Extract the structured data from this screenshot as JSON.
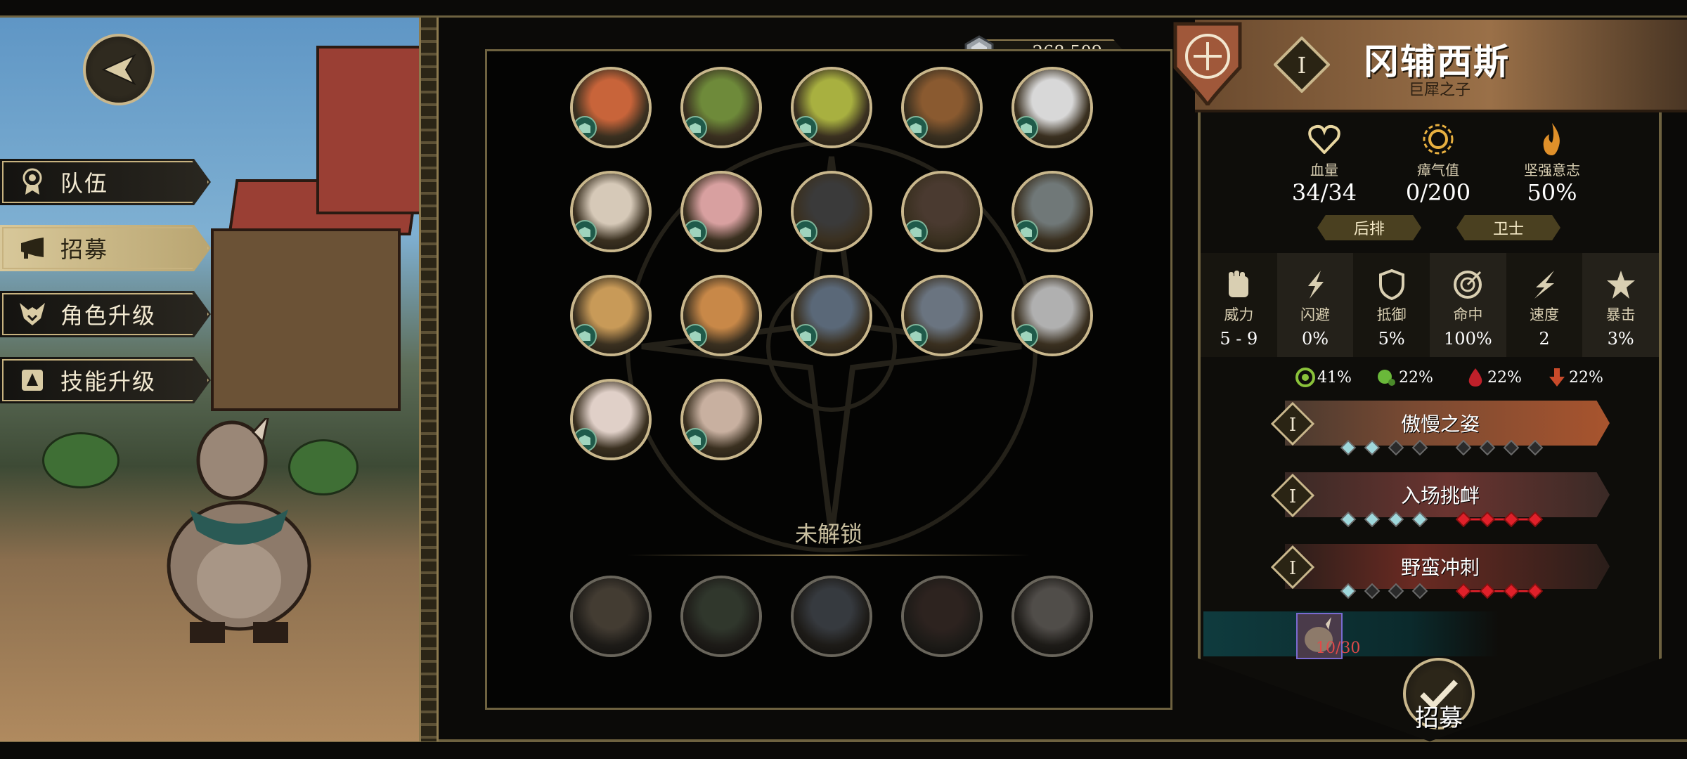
{
  "currency": {
    "value": "268,509",
    "icon": "gem-icon"
  },
  "menu": [
    {
      "label": "队伍",
      "icon": "rosette-icon",
      "active": false
    },
    {
      "label": "招募",
      "icon": "horn-icon",
      "active": true
    },
    {
      "label": "角色升级",
      "icon": "fox-emblem-icon",
      "active": false
    },
    {
      "label": "技能升级",
      "icon": "skill-book-icon",
      "active": false
    }
  ],
  "roster": {
    "unlocked": [
      {
        "name": "fox",
        "color": "#c8643a"
      },
      {
        "name": "lizard",
        "color": "#6e8a3a"
      },
      {
        "name": "jester-frog",
        "color": "#a8b040"
      },
      {
        "name": "bear-guard",
        "color": "#8a5a30"
      },
      {
        "name": "masked-raccoon",
        "color": "#d8d8d8"
      },
      {
        "name": "knight-duck",
        "color": "#d6c9b8"
      },
      {
        "name": "pig-rogue",
        "color": "#d8a0a0"
      },
      {
        "name": "black-cat",
        "color": "#3a3a3a"
      },
      {
        "name": "dark-wolf",
        "color": "#4a3a30"
      },
      {
        "name": "gray-rat",
        "color": "#707878"
      },
      {
        "name": "goggle-mouse",
        "color": "#c89a58"
      },
      {
        "name": "beret-dog",
        "color": "#c88848"
      },
      {
        "name": "armored-rat",
        "color": "#5a6878"
      },
      {
        "name": "owl",
        "color": "#6a7480"
      },
      {
        "name": "monocle-rat",
        "color": "#b0b0b0"
      },
      {
        "name": "pale-pig",
        "color": "#e0d0c8"
      },
      {
        "name": "captain-mouse",
        "color": "#c8b0a0"
      }
    ],
    "locked_label": "未解锁",
    "locked": [
      {
        "name": "hat-mole",
        "color": "#8a6a40"
      },
      {
        "name": "witch-rat",
        "color": "#4a6a3a"
      },
      {
        "name": "rhino-knight",
        "color": "#5a6a80"
      },
      {
        "name": "crow-warrior",
        "color": "#6a3a2a"
      },
      {
        "name": "rhino",
        "color": "#9a8a7a"
      }
    ]
  },
  "character": {
    "rank": "I",
    "name": "冈辅西斯",
    "title": "巨犀之子",
    "hp_label": "血量",
    "hp_value": "34/34",
    "stress_label": "瘴气值",
    "stress_value": "0/200",
    "resolve_label": "坚强意志",
    "resolve_value": "50%",
    "roles": [
      "后排",
      "卫士"
    ],
    "attributes": [
      {
        "label": "威力",
        "value": "5 - 9",
        "icon": "fist-icon"
      },
      {
        "label": "闪避",
        "value": "0%",
        "icon": "dodge-icon"
      },
      {
        "label": "抵御",
        "value": "5%",
        "icon": "shield-icon"
      },
      {
        "label": "命中",
        "value": "100%",
        "icon": "target-icon"
      },
      {
        "label": "速度",
        "value": "2",
        "icon": "speed-icon"
      },
      {
        "label": "暴击",
        "value": "3%",
        "icon": "crit-star-icon"
      }
    ],
    "resistances": [
      {
        "value": "41%",
        "icon": "stun-resist-icon",
        "color": "#8ac23a"
      },
      {
        "value": "22%",
        "icon": "poison-resist-icon",
        "color": "#6ab83a"
      },
      {
        "value": "22%",
        "icon": "bleed-resist-icon",
        "color": "#c0202a"
      },
      {
        "value": "22%",
        "icon": "debuff-resist-icon",
        "color": "#c84a2a"
      }
    ],
    "skills": [
      {
        "rank": "I",
        "name": "傲慢之姿",
        "band": "#a8542e",
        "left_pips": [
          true,
          true,
          false,
          false
        ],
        "right_pips": [
          "off",
          "off",
          "off",
          "off"
        ]
      },
      {
        "rank": "I",
        "name": "入场挑衅",
        "band": "#6a3430",
        "left_pips": [
          true,
          true,
          true,
          true
        ],
        "right_pips": [
          "red",
          "red",
          "red",
          "red"
        ]
      },
      {
        "rank": "I",
        "name": "野蛮冲刺",
        "band": "#4a2a22",
        "left_pips": [
          true,
          false,
          false,
          false
        ],
        "right_pips": [
          "red",
          "red",
          "red",
          "red"
        ]
      }
    ],
    "unit_count": {
      "current": "10",
      "total": "/30"
    },
    "recruit_label": "招募"
  },
  "colors": {
    "gold": "#c9b78c",
    "panel": "#0e0d0a",
    "accent_teal": "#1f5a4a"
  }
}
